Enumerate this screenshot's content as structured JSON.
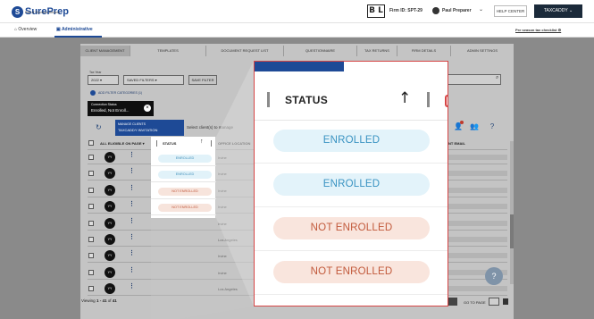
{
  "header": {
    "logo_mark": "S",
    "logo_name": "SurePrep",
    "logo_tagline": "Part of Thomson Reuters",
    "firm_badge": "B L",
    "firm_id": "Firm ID: SPT-29",
    "user_name": "Paul Preparer",
    "help_label": "HELP CENTER",
    "tax_label": "TAXCADDY"
  },
  "subnav": {
    "overview": "Overview",
    "administrative": "Administrative",
    "checklist": "Pre season tax checklist"
  },
  "tabs": [
    {
      "label": "CLIENT MANAGEMENT",
      "active": true
    },
    {
      "label": "TEMPLATES",
      "active": false
    },
    {
      "label": "DOCUMENT REQUEST LIST",
      "active": false
    },
    {
      "label": "QUESTIONNAIRE",
      "active": false
    },
    {
      "label": "TAX RETURNS",
      "active": false
    },
    {
      "label": "FIRM DETAILS",
      "active": false
    },
    {
      "label": "ADMIN SETTINGS",
      "active": false
    }
  ],
  "filters": {
    "tax_year_label": "Tax Year",
    "tax_year_value": "2022",
    "saved_filters_value": "SAVED FILTERS",
    "save_filter_label": "SAVE FILTER",
    "add_filter_label": "ADD FILTER CATEGORIES",
    "add_filter_count": "(1)"
  },
  "active_filter": {
    "label": "Connection Status",
    "value": "Enrolled, Not Enroll..."
  },
  "toolbar": {
    "manage_label": "MANAGE CLIENTS",
    "manage_value": "TAXCADDY INVITATION",
    "select_hint": "Select client(s) to manage"
  },
  "table": {
    "headers": {
      "all_eligible": "ALL ELIGIBLE ON PAGE",
      "status": "STATUS",
      "office_location": "OFFICE LOCATION",
      "email": "NT EMAIL"
    },
    "rows": [
      {
        "avatar": "YY",
        "status": "ENROLLED",
        "enrolled": true,
        "location": "Irvine"
      },
      {
        "avatar": "YY",
        "status": "ENROLLED",
        "enrolled": true,
        "location": "Irvine"
      },
      {
        "avatar": "YY",
        "status": "NOT ENROLLED",
        "enrolled": false,
        "location": "Irvine"
      },
      {
        "avatar": "YY",
        "status": "NOT ENROLLED",
        "enrolled": false,
        "location": "Irvine"
      },
      {
        "avatar": "YY",
        "status": "NOT ENROLLED",
        "enrolled": false,
        "location": "Irvine"
      },
      {
        "avatar": "YY",
        "status": "NOT ENROLLED",
        "enrolled": false,
        "location": "Los Angeles"
      },
      {
        "avatar": "YY",
        "status": "NOT ENROLLED",
        "enrolled": false,
        "location": "Irvine"
      },
      {
        "avatar": "YY",
        "status": "NOT ENROLLED",
        "enrolled": false,
        "location": "Irvine"
      },
      {
        "avatar": "YY",
        "status": "NOT ENROLLED",
        "enrolled": false,
        "location": "Los Angeles"
      }
    ]
  },
  "footer": {
    "viewing_prefix": "Viewing",
    "range": "1 - 41",
    "of": "of",
    "total": "41",
    "goto_label": "GO TO PAGE",
    "goto_value": "1"
  },
  "zoom": {
    "title": "STATUS",
    "sort_glyph": "↑",
    "pills": [
      "ENROLLED",
      "ENROLLED",
      "NOT ENROLLED",
      "NOT ENROLLED"
    ]
  },
  "colors": {
    "brand": "#1e4a96",
    "enrolled_bg": "#e3f3fa",
    "enrolled_text": "#3a93c2",
    "not_enrolled_bg": "#f9e5dd",
    "not_enrolled_text": "#c25a3c",
    "callout_border": "#d64545"
  }
}
